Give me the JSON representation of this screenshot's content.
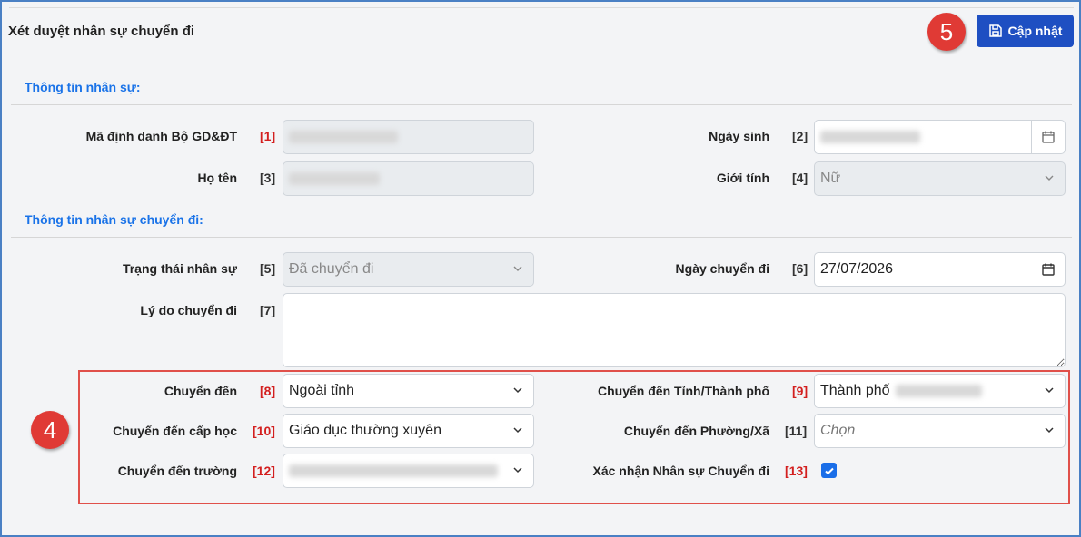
{
  "header": {
    "title": "Xét duyệt nhân sự chuyển đi",
    "update_label": "Cập nhật"
  },
  "badges": {
    "update": "5",
    "transfer": "4"
  },
  "sections": {
    "personnel": "Thông tin nhân sự:",
    "transfer": "Thông tin nhân sự chuyển đi:"
  },
  "fields": {
    "ma_dinh_danh": {
      "label": "Mã định danh Bộ GD&ĐT",
      "num": "[1]"
    },
    "ngay_sinh": {
      "label": "Ngày sinh",
      "num": "[2]"
    },
    "ho_ten": {
      "label": "Họ tên",
      "num": "[3]"
    },
    "gioi_tinh": {
      "label": "Giới tính",
      "num": "[4]",
      "value": "Nữ"
    },
    "trang_thai": {
      "label": "Trạng thái nhân sự",
      "num": "[5]",
      "value": "Đã chuyển đi"
    },
    "ngay_chuyen_di": {
      "label": "Ngày chuyển đi",
      "num": "[6]",
      "value": "27/07/2026"
    },
    "ly_do": {
      "label": "Lý do chuyển đi",
      "num": "[7]"
    },
    "chuyen_den": {
      "label": "Chuyển đến",
      "num": "[8]",
      "value": "Ngoài tỉnh"
    },
    "tinh_tp": {
      "label": "Chuyển đến Tỉnh/Thành phố",
      "num": "[9]",
      "value": "Thành phố"
    },
    "cap_hoc": {
      "label": "Chuyển đến cấp học",
      "num": "[10]",
      "value": "Giáo dục thường xuyên"
    },
    "phuong_xa": {
      "label": "Chuyển đến Phường/Xã",
      "num": "[11]",
      "placeholder": "Chọn"
    },
    "truong": {
      "label": "Chuyển đến trường",
      "num": "[12]"
    },
    "xac_nhan": {
      "label": "Xác nhận Nhân sự Chuyển đi",
      "num": "[13]"
    }
  },
  "colors": {
    "accent": "#1e4fc2",
    "section": "#1a73e8",
    "highlight": "#e0504a",
    "required": "#d31f1f"
  }
}
